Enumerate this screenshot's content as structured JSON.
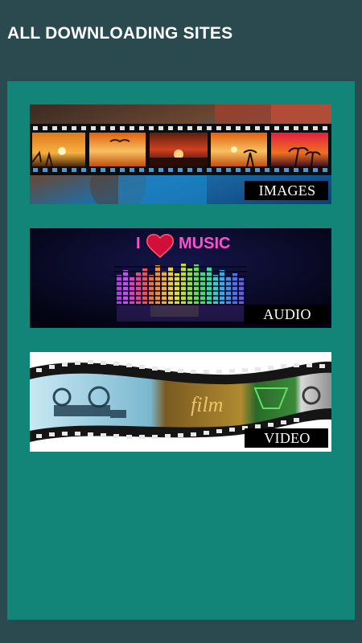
{
  "app": {
    "title": "ALL DOWNLOADING SITES"
  },
  "cards": [
    {
      "id": "images",
      "label": "IMAGES"
    },
    {
      "id": "audio",
      "label": "AUDIO",
      "banner_text": "I ♥ MUSIC"
    },
    {
      "id": "video",
      "label": "VIDEO",
      "banner_text": "film"
    }
  ],
  "colors": {
    "app_bar": "#2a4a50",
    "content_bg": "#138478",
    "label_bg": "#000000",
    "label_text": "#ffffff"
  }
}
